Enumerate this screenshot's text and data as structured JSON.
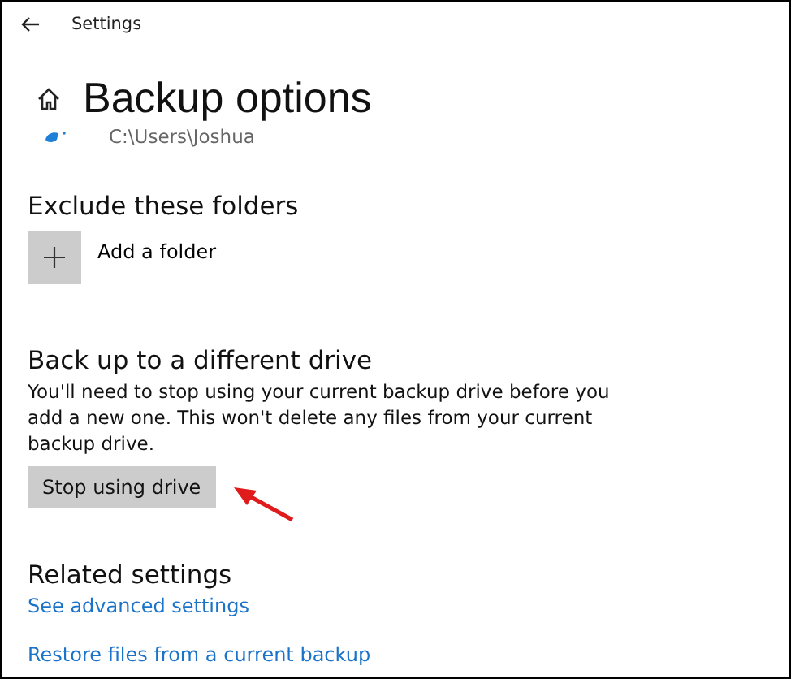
{
  "window": {
    "title": "Settings"
  },
  "page": {
    "title": "Backup options",
    "path": "C:\\Users\\Joshua"
  },
  "exclude": {
    "heading": "Exclude these folders",
    "add_label": "Add a folder"
  },
  "different_drive": {
    "heading": "Back up to a different drive",
    "description": "You'll need to stop using your current backup drive before you add a new one. This won't delete any files from your current backup drive.",
    "button": "Stop using drive"
  },
  "related": {
    "heading": "Related settings",
    "links": [
      "See advanced settings",
      "Restore files from a current backup"
    ]
  }
}
